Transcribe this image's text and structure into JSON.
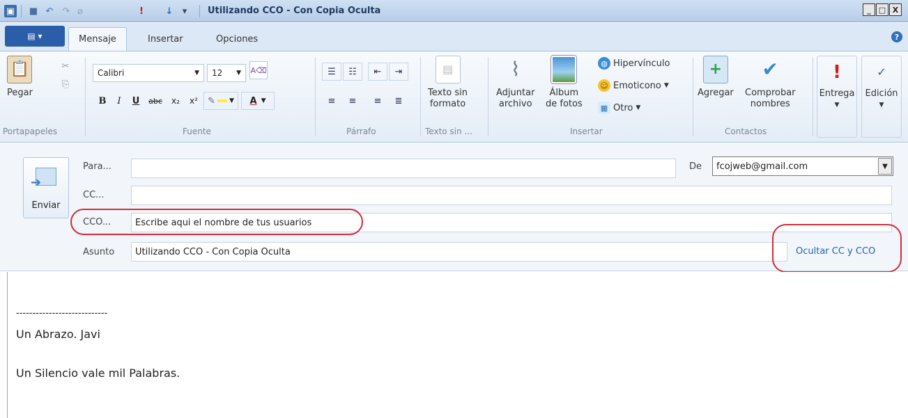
{
  "window": {
    "title": "Utilizando CCO - Con Copia Oculta",
    "minimize": "_",
    "maximize": "□",
    "close": "X"
  },
  "tabs": [
    {
      "label": "Mensaje"
    },
    {
      "label": "Insertar"
    },
    {
      "label": "Opciones"
    }
  ],
  "ribbon": {
    "clipboard": {
      "paste": "Pegar",
      "group": "Portapapeles"
    },
    "font": {
      "name": "Calibri",
      "size": "12",
      "bold": "B",
      "italic": "I",
      "underline": "U",
      "strike": "abc",
      "subscript": "x₂",
      "superscript": "x²",
      "color": "A",
      "group": "Fuente"
    },
    "paragraph": {
      "group": "Párrafo"
    },
    "plaintext": {
      "label_1": "Texto sin",
      "label_2": "formato",
      "group": "Texto sin ..."
    },
    "insert": {
      "attach_1": "Adjuntar",
      "attach_2": "archivo",
      "photos_1": "Álbum",
      "photos_2": "de fotos",
      "hyperlink": "Hipervínculo",
      "emoticon": "Emoticono",
      "other": "Otro",
      "group": "Insertar"
    },
    "contacts": {
      "add": "Agregar",
      "check_1": "Comprobar",
      "check_2": "nombres",
      "group": "Contactos"
    },
    "delivery": {
      "label": "Entrega"
    },
    "editing": {
      "label": "Edición"
    }
  },
  "form": {
    "send": "Enviar",
    "to_label": "Para...",
    "to_value": "",
    "cc_label": "CC...",
    "cc_value": "",
    "bcc_label": "CCO...",
    "bcc_value": "Escribe aqui el nombre de tus usuarios",
    "subject_label": "Asunto",
    "subject_value": "Utilizando CCO - Con Copia Oculta",
    "from_label": "De",
    "from_value": "fcojweb@gmail.com",
    "hide_link": "Ocultar CC y CCO"
  },
  "body": {
    "separator": "----------------------------",
    "line1": "Un Abrazo. Javi",
    "line2": "Un Silencio vale mil Palabras."
  },
  "colors": {
    "accent": "#2a5ea8",
    "highlight": "#d42a3a",
    "link": "#1c63b7"
  }
}
